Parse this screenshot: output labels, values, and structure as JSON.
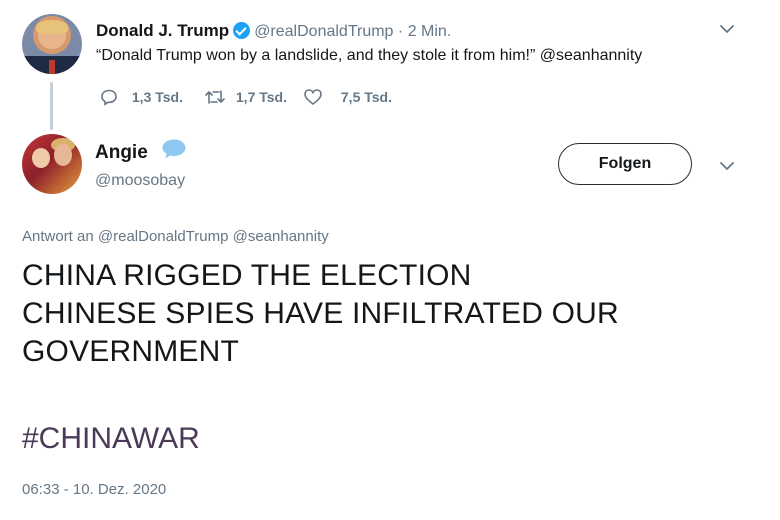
{
  "quoted_tweet": {
    "author_name": "Donald J. Trump",
    "author_handle": "@realDonaldTrump",
    "separator": "·",
    "time_ago": "2 Min.",
    "text": "“Donald Trump won by a landslide, and they stole it from him!” @seanhannity",
    "replies": "1,3 Tsd.",
    "retweets": "1,7 Tsd.",
    "likes": "7,5 Tsd.",
    "menu_icon": "chevron-down-icon"
  },
  "reply_tweet": {
    "author_name": "Angie",
    "author_handle": "@moosobay",
    "follow_label": "Folgen",
    "name_emoji_icon": "speech-bubble-icon",
    "reply_to_label": "Antwort an",
    "reply_to_mentions": "@realDonaldTrump @seanhannity",
    "body_lines": [
      "CHINA RIGGED THE ELECTION",
      "CHINESE SPIES HAVE INFILTRATED OUR",
      "GOVERNMENT"
    ],
    "hashtag": "#CHINAWAR",
    "timestamp": "06:33 - 10. Dez. 2020",
    "menu_icon": "chevron-down-icon"
  },
  "colors": {
    "verified_blue": "#1da1f2",
    "muted_text": "#657786",
    "hashtag": "#4a3a57"
  }
}
